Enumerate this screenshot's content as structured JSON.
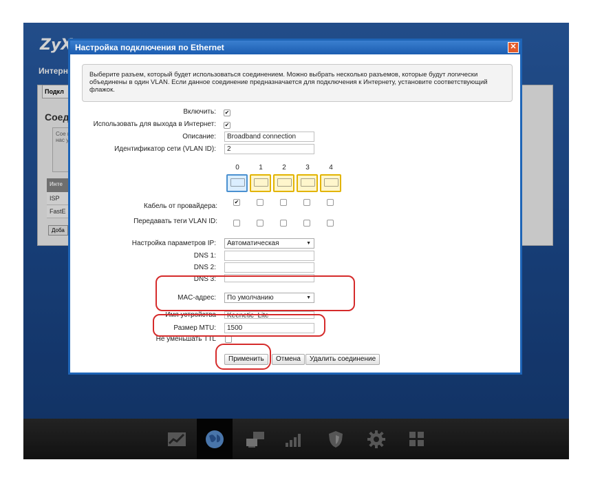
{
  "app": {
    "logo": "ZyX",
    "subtitle": "Интерн"
  },
  "background": {
    "tab": "Подкл",
    "section": "Соед",
    "box_text": "Сое нео нас указ",
    "table_header": "Инте",
    "rows": [
      "ISP",
      "FastE"
    ],
    "add_button": "Доба"
  },
  "dialog": {
    "title": "Настройка подключения по Ethernet",
    "close": "✕",
    "info": "Выберите разъем, который будет использоваться соединением. Можно выбрать несколько разъемов, которые будут логически объединены в один VLAN. Если данное соединение предназначается для подключения к Интернету, установите соответствующий флажок.",
    "enable_label": "Включить:",
    "enable_checked": true,
    "internet_label": "Использовать для выхода в Интернет:",
    "internet_checked": true,
    "description_label": "Описание:",
    "description_value": "Broadband connection",
    "vlan_label": "Идентификатор сети (VLAN ID):",
    "vlan_value": "2",
    "ports": [
      "0",
      "1",
      "2",
      "3",
      "4"
    ],
    "cable_label": "Кабель от провайдера:",
    "cable_checks": [
      true,
      false,
      false,
      false,
      false
    ],
    "tags_label": "Передавать теги VLAN ID:",
    "tags_checks": [
      false,
      false,
      false,
      false,
      false
    ],
    "ip_label": "Настройка параметров IP:",
    "ip_value": "Автоматическая",
    "dns1_label": "DNS 1:",
    "dns2_label": "DNS 2:",
    "dns3_label": "DNS 3:",
    "mac_label": "MAC-адрес:",
    "mac_value": "По умолчанию",
    "device_label": "Имя устройства",
    "device_value": "Keenetic_Lite",
    "mtu_label": "Размер MTU:",
    "mtu_value": "1500",
    "ttl_label": "Не уменьшать TTL",
    "apply": "Применить",
    "cancel": "Отмена",
    "delete": "Удалить соединение"
  },
  "taskbar": {
    "icons": [
      "chart-icon",
      "globe-icon",
      "network-icon",
      "signal-icon",
      "shield-icon",
      "gear-icon",
      "apps-icon"
    ],
    "active": "globe-icon"
  },
  "colors": {
    "titlebar": "#1c5db0",
    "highlight": "#d52a2a",
    "port_lan": "#e2b400",
    "port_wan": "#4a90d0"
  }
}
